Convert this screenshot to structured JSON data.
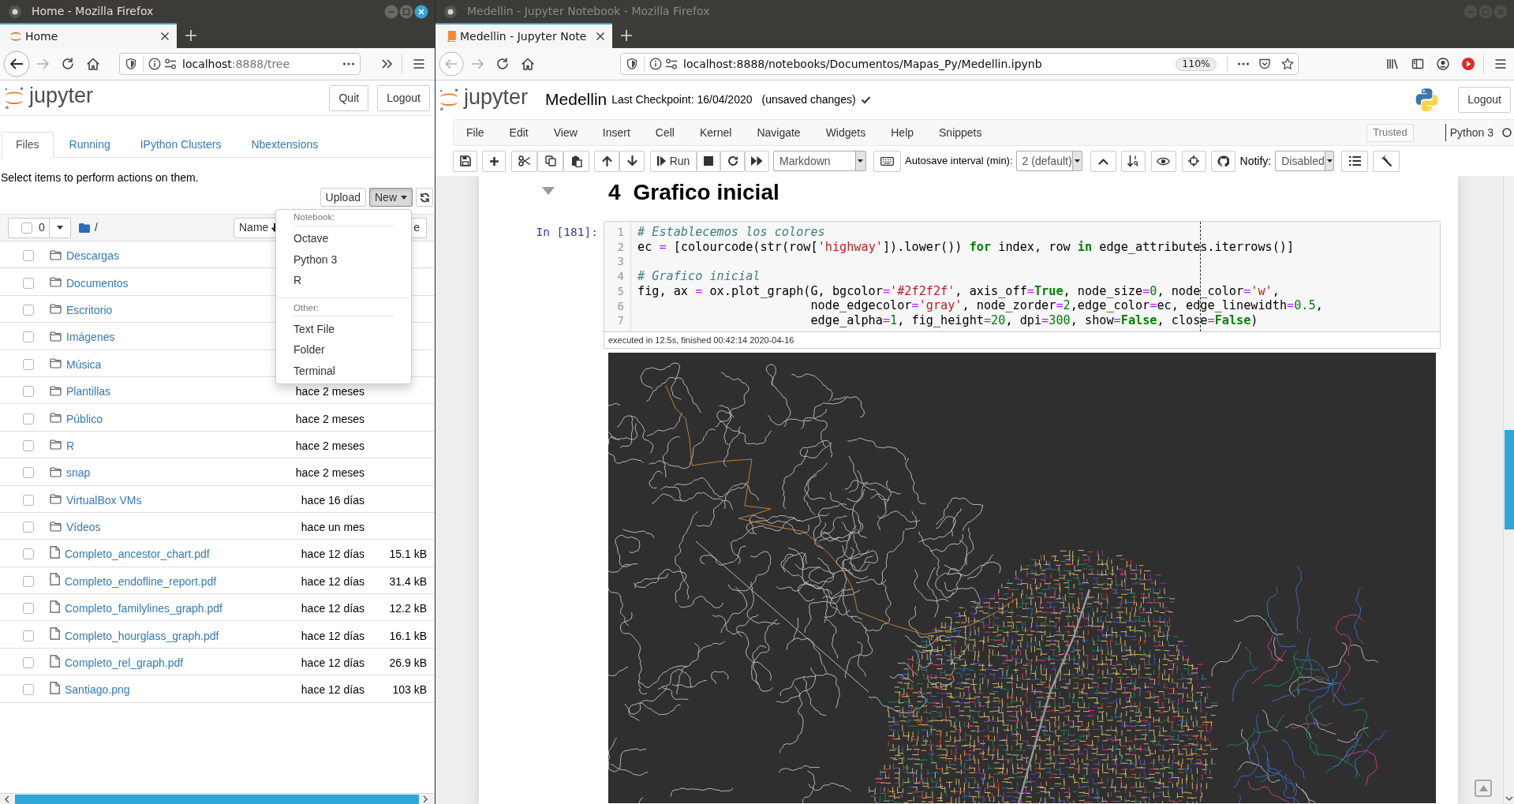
{
  "home_window": {
    "title": "Home - Mozilla Firefox",
    "active": true,
    "tabs": [
      {
        "label": "Home",
        "selected": true
      }
    ],
    "nav": {
      "back_enabled": true,
      "forward_enabled": false
    },
    "url": {
      "domain": "localhost",
      "path": ":8888/tree",
      "path_dimmed": true
    },
    "logo_text": "jupyter",
    "header_buttons": [
      "Quit",
      "Logout"
    ],
    "page_tabs": [
      {
        "label": "Files",
        "selected": true
      },
      {
        "label": "Running",
        "selected": false
      },
      {
        "label": "IPython Clusters",
        "selected": false
      },
      {
        "label": "Nbextensions",
        "selected": false
      }
    ],
    "instruction": "Select items to perform actions on them.",
    "actions": [
      {
        "label": "Upload",
        "pressed": false,
        "caret": false
      },
      {
        "label": "New",
        "pressed": true,
        "caret": true
      }
    ],
    "list_header": {
      "checked": false,
      "selected_count": "0",
      "path": "/",
      "sort_column": "Name",
      "column_3": "e"
    },
    "files": [
      {
        "name": "Descargas",
        "kind": "folder",
        "checked": false
      },
      {
        "name": "Documentos",
        "kind": "folder",
        "checked": false
      },
      {
        "name": "Escritorio",
        "kind": "folder",
        "checked": false
      },
      {
        "name": "Imágenes",
        "kind": "folder",
        "checked": false
      },
      {
        "name": "Música",
        "kind": "folder",
        "checked": false
      },
      {
        "name": "Plantillas",
        "kind": "folder",
        "checked": false,
        "modified": "hace 2 meses"
      },
      {
        "name": "Público",
        "kind": "folder",
        "checked": false,
        "modified": "hace 2 meses"
      },
      {
        "name": "R",
        "kind": "folder",
        "checked": false,
        "modified": "hace 2 meses"
      },
      {
        "name": "snap",
        "kind": "folder",
        "checked": false,
        "modified": "hace 2 meses"
      },
      {
        "name": "VirtualBox VMs",
        "kind": "folder",
        "checked": false,
        "modified": "hace 16 días"
      },
      {
        "name": "Vídeos",
        "kind": "folder",
        "checked": false,
        "modified": "hace un mes"
      },
      {
        "name": "Completo_ancestor_chart.pdf",
        "kind": "file",
        "checked": false,
        "modified": "hace 12 días",
        "size": "15.1 kB"
      },
      {
        "name": "Completo_endofline_report.pdf",
        "kind": "file",
        "checked": false,
        "modified": "hace 12 días",
        "size": "31.4 kB"
      },
      {
        "name": "Completo_familylines_graph.pdf",
        "kind": "file",
        "checked": false,
        "modified": "hace 12 días",
        "size": "12.2 kB"
      },
      {
        "name": "Completo_hourglass_graph.pdf",
        "kind": "file",
        "checked": false,
        "modified": "hace 12 días",
        "size": "16.1 kB"
      },
      {
        "name": "Completo_rel_graph.pdf",
        "kind": "file",
        "checked": false,
        "modified": "hace 12 días",
        "size": "26.9 kB"
      },
      {
        "name": "Santiago.png",
        "kind": "file",
        "checked": false,
        "modified": "hace 12 días",
        "size": "103 kB"
      }
    ],
    "new_menu": [
      {
        "heading": "Notebook:",
        "items": [
          "Octave",
          "Python 3",
          "R"
        ]
      },
      {
        "heading": "Other:",
        "items": [
          "Text File",
          "Folder",
          "Terminal"
        ]
      }
    ]
  },
  "notebook_window": {
    "title": "Medellin - Jupyter Notebook - Mozilla Firefox",
    "active": false,
    "tabs": [
      {
        "label": "Medellin - Jupyter Note",
        "selected": true
      }
    ],
    "nav": {
      "back_enabled": false,
      "forward_enabled": false
    },
    "url": {
      "domain": "localhost",
      "path": ":8888/notebooks/Documentos/Mapas_Py/Medellin.ipynb",
      "path_dimmed": false
    },
    "zoom": "110%",
    "logo_text": "jupyter",
    "notebook_name": "Medellin",
    "checkpoint": "Last Checkpoint: 16/04/2020",
    "autosave_status": "(unsaved changes)",
    "logout": "Logout",
    "menu": [
      "File",
      "Edit",
      "View",
      "Insert",
      "Cell",
      "Kernel",
      "Navigate",
      "Widgets",
      "Help",
      "Snippets"
    ],
    "trusted": "Trusted",
    "kernel": {
      "name": "Python 3",
      "busy": false
    },
    "toolbar": {
      "run_label": "Run",
      "cell_type": "Markdown",
      "autosave_label": "Autosave interval (min):",
      "autosave_value": "2 (default)",
      "notify_label": "Notify:",
      "notify_value": "Disabled"
    },
    "heading": {
      "number": "4",
      "text": "Grafico inicial"
    },
    "cell": {
      "prompt": "In [181]:",
      "lines": [
        {
          "number": "1",
          "tokens": [
            {
              "text": "# Establecemos los colores",
              "kind": "comment"
            }
          ]
        },
        {
          "number": "2",
          "tokens": [
            {
              "text": "ec ",
              "kind": "plain"
            },
            {
              "text": "=",
              "kind": "operator"
            },
            {
              "text": " [colourcode(str(row[",
              "kind": "plain"
            },
            {
              "text": "'highway'",
              "kind": "string"
            },
            {
              "text": "]).lower()) ",
              "kind": "plain"
            },
            {
              "text": "for",
              "kind": "keyword"
            },
            {
              "text": " index, row ",
              "kind": "plain"
            },
            {
              "text": "in",
              "kind": "keyword"
            },
            {
              "text": " edge_attributes.iterrows()]",
              "kind": "plain"
            }
          ]
        },
        {
          "number": "3"
        },
        {
          "number": "4",
          "tokens": [
            {
              "text": "# Grafico inicial",
              "kind": "comment"
            }
          ]
        },
        {
          "number": "5",
          "tokens": [
            {
              "text": "fig, ax ",
              "kind": "plain"
            },
            {
              "text": "=",
              "kind": "operator"
            },
            {
              "text": " ox.plot_graph(G, bgcolor",
              "kind": "plain"
            },
            {
              "text": "=",
              "kind": "operator"
            },
            {
              "text": "'#2f2f2f'",
              "kind": "string"
            },
            {
              "text": ", axis_off",
              "kind": "plain"
            },
            {
              "text": "=",
              "kind": "operator"
            },
            {
              "text": "True",
              "kind": "keyword"
            },
            {
              "text": ", node_size",
              "kind": "plain"
            },
            {
              "text": "=",
              "kind": "operator"
            },
            {
              "text": "0",
              "kind": "number"
            },
            {
              "text": ", node_color",
              "kind": "plain"
            },
            {
              "text": "=",
              "kind": "operator"
            },
            {
              "text": "'w'",
              "kind": "string"
            },
            {
              "text": ",",
              "kind": "plain"
            }
          ]
        },
        {
          "number": "6",
          "tokens": [
            {
              "text": "                        node_edgecolor",
              "kind": "plain"
            },
            {
              "text": "=",
              "kind": "operator"
            },
            {
              "text": "'gray'",
              "kind": "string"
            },
            {
              "text": ", node_zorder",
              "kind": "plain"
            },
            {
              "text": "=",
              "kind": "operator"
            },
            {
              "text": "2",
              "kind": "number"
            },
            {
              "text": ",edge_color",
              "kind": "plain"
            },
            {
              "text": "=",
              "kind": "operator"
            },
            {
              "text": "ec, edge_linewidth",
              "kind": "plain"
            },
            {
              "text": "=",
              "kind": "operator"
            },
            {
              "text": "0.5",
              "kind": "number"
            },
            {
              "text": ",",
              "kind": "plain"
            }
          ]
        },
        {
          "number": "7",
          "tokens": [
            {
              "text": "                        edge_alpha",
              "kind": "plain"
            },
            {
              "text": "=",
              "kind": "operator"
            },
            {
              "text": "1",
              "kind": "number"
            },
            {
              "text": ", fig_height",
              "kind": "plain"
            },
            {
              "text": "=",
              "kind": "operator"
            },
            {
              "text": "20",
              "kind": "number"
            },
            {
              "text": ", dpi",
              "kind": "plain"
            },
            {
              "text": "=",
              "kind": "operator"
            },
            {
              "text": "300",
              "kind": "number"
            },
            {
              "text": ", show",
              "kind": "plain"
            },
            {
              "text": "=",
              "kind": "operator"
            },
            {
              "text": "False",
              "kind": "keyword"
            },
            {
              "text": ", close",
              "kind": "plain"
            },
            {
              "text": "=",
              "kind": "operator"
            },
            {
              "text": "False",
              "kind": "keyword"
            },
            {
              "text": ")",
              "kind": "plain"
            }
          ]
        }
      ],
      "execution_info": "executed in 12.5s, finished 00:42:14 2020-04-16"
    }
  }
}
